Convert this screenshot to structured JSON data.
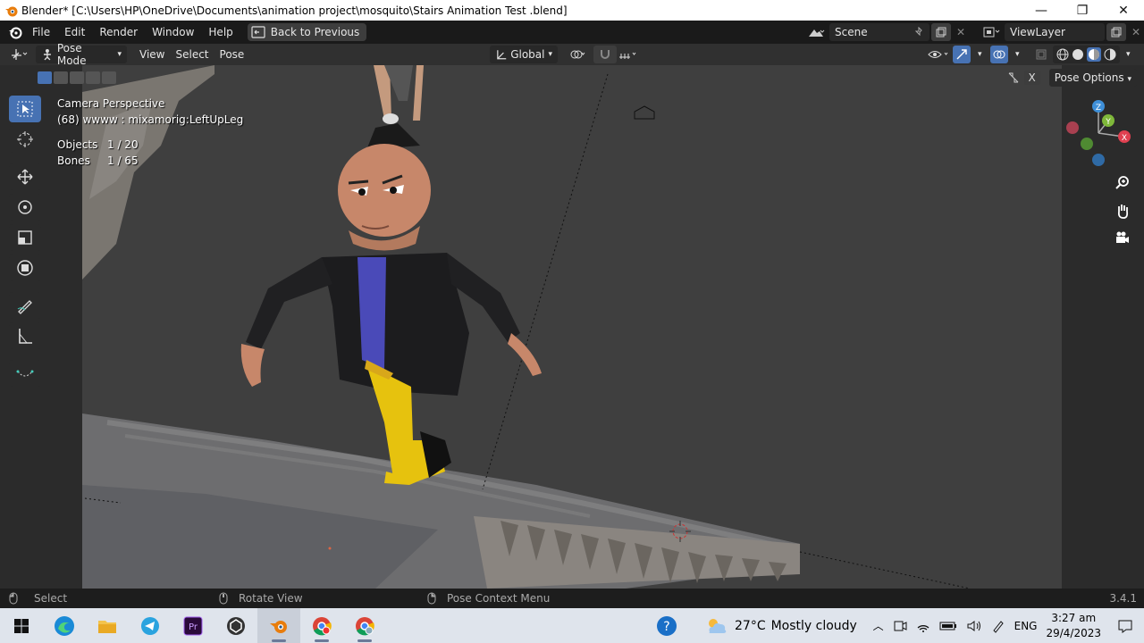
{
  "window": {
    "title": "Blender* [C:\\Users\\HP\\OneDrive\\Documents\\animation project\\mosquito\\Stairs Animation Test .blend]",
    "controls": [
      "—",
      "❐",
      "✕"
    ]
  },
  "menubar": {
    "items": [
      "File",
      "Edit",
      "Render",
      "Window",
      "Help"
    ],
    "back_label": "Back to Previous",
    "scene_value": "Scene",
    "viewlayer_value": "ViewLayer"
  },
  "header3d": {
    "mode": "Pose Mode",
    "menus": [
      "View",
      "Select",
      "Pose"
    ],
    "transform_orientation": "Global",
    "pose_options": "Pose Options",
    "close_x": "X"
  },
  "viewport": {
    "view_name": "Camera Perspective",
    "frame_info": "(68) wwww : mixamorig:LeftUpLeg",
    "objects_label": "Objects",
    "objects_value": "1 / 20",
    "bones_label": "Bones",
    "bones_value": "1 / 65",
    "gizmo_axes": [
      "X",
      "Y",
      "Z"
    ]
  },
  "statusbar": {
    "select": "Select",
    "rotate": "Rotate View",
    "context": "Pose Context Menu",
    "version": "3.4.1"
  },
  "taskbar": {
    "weather_temp": "27°C",
    "weather_desc": "Mostly cloudy",
    "language": "ENG",
    "time": "3:27 am",
    "date": "29/4/2023"
  },
  "colors": {
    "accent": "#4772b3",
    "viewport_bg": "#3c3c3c",
    "axis_x": "#e04050",
    "axis_y": "#7fb83a",
    "axis_z": "#3e8fd8"
  }
}
